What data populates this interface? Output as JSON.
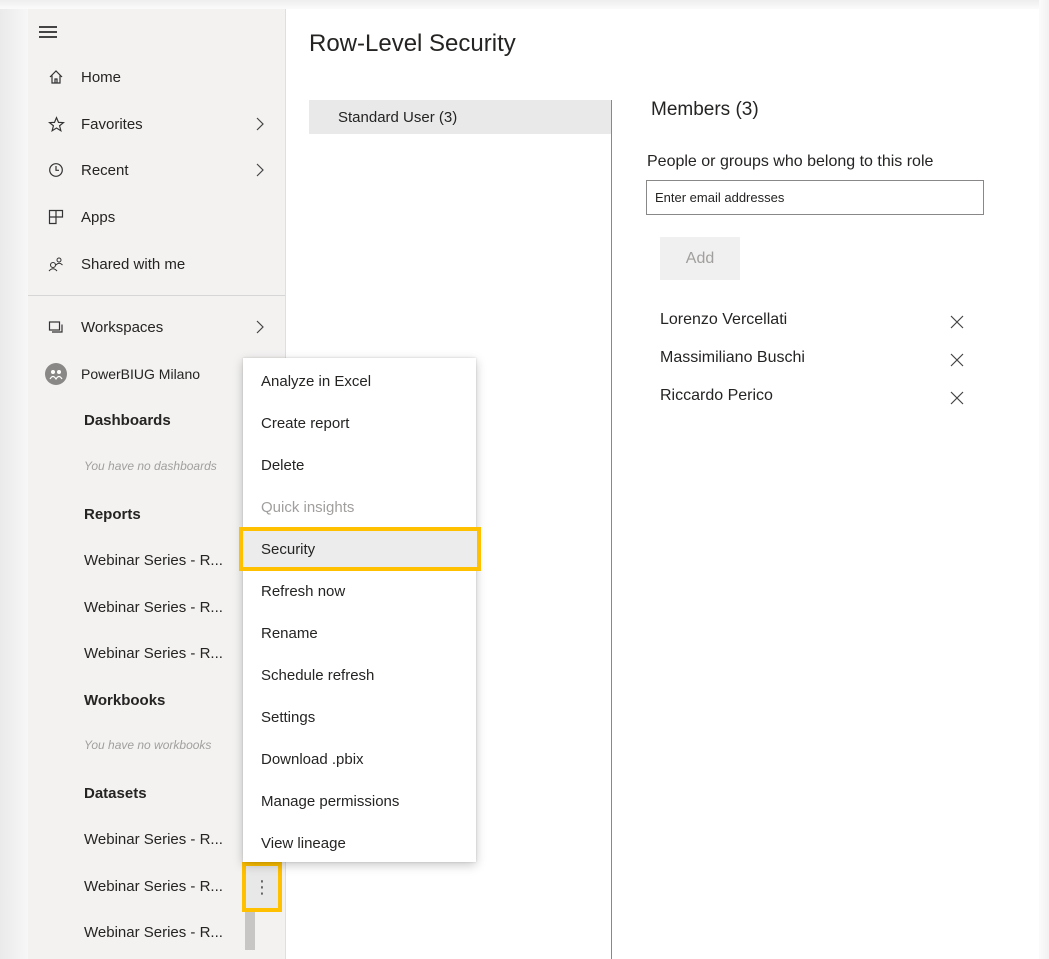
{
  "sidebar": {
    "nav": [
      {
        "label": "Home",
        "icon": "home-icon"
      },
      {
        "label": "Favorites",
        "icon": "star-icon"
      },
      {
        "label": "Recent",
        "icon": "clock-icon"
      },
      {
        "label": "Apps",
        "icon": "apps-icon"
      },
      {
        "label": "Shared with me",
        "icon": "shared-icon"
      }
    ],
    "workspaces_label": "Workspaces",
    "workspace_name": "PowerBIUG Milano",
    "sections": {
      "dashboards": {
        "title": "Dashboards",
        "empty": "You have no dashboards"
      },
      "reports": {
        "title": "Reports",
        "items": [
          "Webinar Series - R...",
          "Webinar Series - R...",
          "Webinar Series - R..."
        ]
      },
      "workbooks": {
        "title": "Workbooks",
        "empty": "You have no workbooks"
      },
      "datasets": {
        "title": "Datasets",
        "items": [
          "Webinar Series - R...",
          "Webinar Series - R...",
          "Webinar Series - R..."
        ]
      }
    },
    "more_button_glyph": "⋮"
  },
  "context_menu": {
    "items": [
      {
        "label": "Analyze in Excel",
        "state": "normal"
      },
      {
        "label": "Create report",
        "state": "normal"
      },
      {
        "label": "Delete",
        "state": "normal"
      },
      {
        "label": "Quick insights",
        "state": "disabled"
      },
      {
        "label": "Security",
        "state": "highlighted"
      },
      {
        "label": "Refresh now",
        "state": "normal"
      },
      {
        "label": "Rename",
        "state": "normal"
      },
      {
        "label": "Schedule refresh",
        "state": "normal"
      },
      {
        "label": "Settings",
        "state": "normal"
      },
      {
        "label": "Download .pbix",
        "state": "normal"
      },
      {
        "label": "Manage permissions",
        "state": "normal"
      },
      {
        "label": "View lineage",
        "state": "normal"
      }
    ]
  },
  "main": {
    "title": "Row-Level Security",
    "roles": [
      {
        "label": "Standard User (3)"
      }
    ],
    "members": {
      "title": "Members (3)",
      "description": "People or groups who belong to this role",
      "input_placeholder": "Enter email addresses",
      "add_label": "Add",
      "list": [
        "Lorenzo Vercellati",
        "Massimiliano Buschi",
        "Riccardo Perico"
      ]
    }
  },
  "colors": {
    "highlight": "#ffc000",
    "sidebar_bg": "#f3f2f1",
    "text": "#252423",
    "disabled_text": "#a19f9d"
  }
}
